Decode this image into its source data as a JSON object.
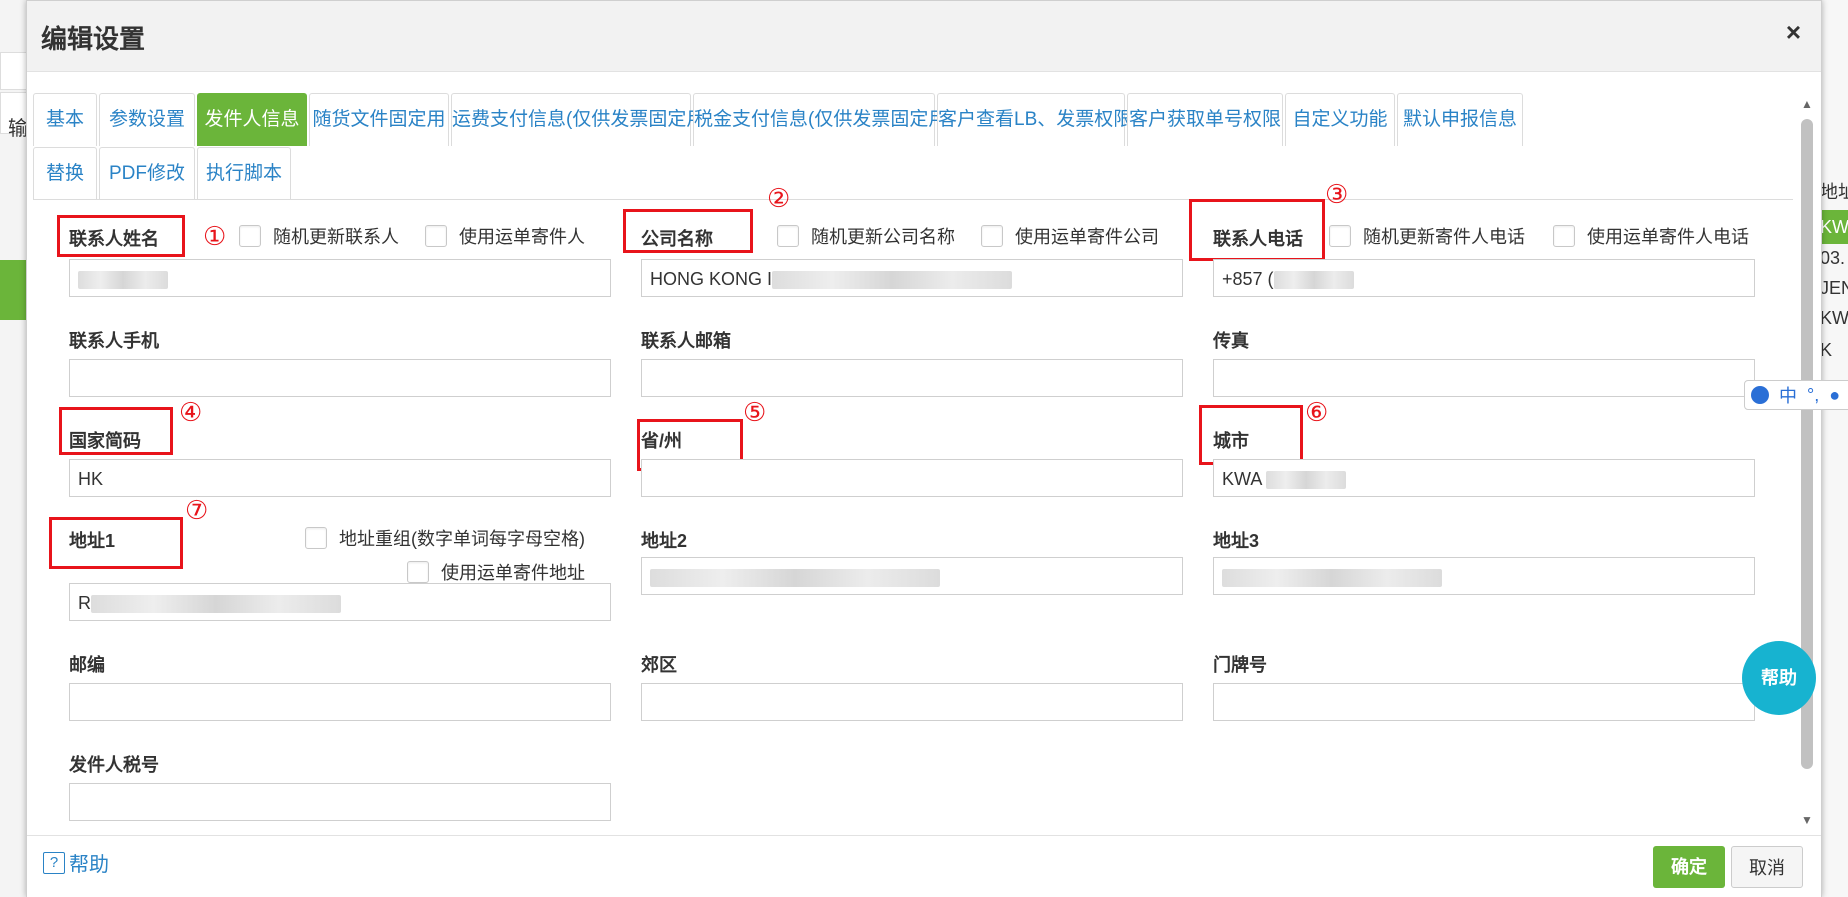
{
  "dialog": {
    "title": "编辑设置",
    "close_glyph": "×"
  },
  "tabs": [
    {
      "label": "基本",
      "active": false
    },
    {
      "label": "参数设置",
      "active": false
    },
    {
      "label": "发件人信息",
      "active": true
    },
    {
      "label": "随货文件固定用",
      "active": false
    },
    {
      "label": "运费支付信息(仅供发票固定用)",
      "active": false
    },
    {
      "label": "税金支付信息(仅供发票固定用)",
      "active": false
    },
    {
      "label": "客户查看LB、发票权限",
      "active": false
    },
    {
      "label": "客户获取单号权限",
      "active": false
    },
    {
      "label": "自定义功能",
      "active": false
    },
    {
      "label": "默认申报信息",
      "active": false
    },
    {
      "label": "替换",
      "active": false
    },
    {
      "label": "PDF修改",
      "active": false
    },
    {
      "label": "执行脚本",
      "active": false
    }
  ],
  "form": {
    "contact_name": {
      "label": "联系人姓名",
      "value": "",
      "cb1": "随机更新联系人",
      "cb2": "使用运单寄件人"
    },
    "company": {
      "label": "公司名称",
      "value": "HONG KONG I",
      "cb1": "随机更新公司名称",
      "cb2": "使用运单寄件公司"
    },
    "phone": {
      "label": "联系人电话",
      "value": "+857 (",
      "cb1": "随机更新寄件人电话",
      "cb2": "使用运单寄件人电话"
    },
    "mobile": {
      "label": "联系人手机",
      "value": ""
    },
    "email": {
      "label": "联系人邮箱",
      "value": ""
    },
    "fax": {
      "label": "传真",
      "value": ""
    },
    "country": {
      "label": "国家简码",
      "value": "HK"
    },
    "state": {
      "label": "省/州",
      "value": ""
    },
    "city": {
      "label": "城市",
      "value": "KWA"
    },
    "address1": {
      "label": "地址1",
      "value": "R",
      "cb1": "地址重组(数字单词每字母空格)",
      "cb2": "使用运单寄件地址"
    },
    "address2": {
      "label": "地址2",
      "value": ""
    },
    "address3": {
      "label": "地址3",
      "value": ""
    },
    "postcode": {
      "label": "邮编",
      "value": ""
    },
    "suburb": {
      "label": "郊区",
      "value": ""
    },
    "house_no": {
      "label": "门牌号",
      "value": ""
    },
    "tax_no": {
      "label": "发件人税号",
      "value": ""
    }
  },
  "annotations": [
    "①",
    "②",
    "③",
    "④",
    "⑤",
    "⑥",
    "⑦"
  ],
  "footer": {
    "help": "帮助",
    "help_glyph": "?",
    "ok": "确定",
    "cancel": "取消"
  },
  "fab": {
    "label": "帮助"
  },
  "ime": {
    "mode": "中",
    "punct": "°,"
  },
  "background": {
    "left_char": "输",
    "right_items": [
      "地址",
      "KW",
      "03.",
      "JEN",
      "KW",
      "K"
    ]
  },
  "colors": {
    "accent_green": "#6bb53a",
    "link_blue": "#2a83c6",
    "annotation_red": "#e8141b",
    "fab_cyan": "#17b3d0"
  }
}
